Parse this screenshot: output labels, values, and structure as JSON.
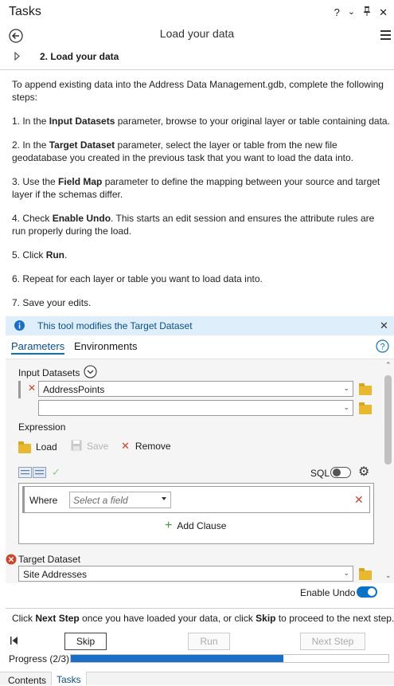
{
  "window": {
    "title": "Tasks",
    "icons": [
      "help-icon",
      "dropdown-icon",
      "pin-icon",
      "close-icon"
    ]
  },
  "header": {
    "title": "Load your data"
  },
  "step": {
    "label": "2.  Load your data"
  },
  "instructions": [
    {
      "parts": [
        {
          "t": "To append existing data into the Address Data Management.gdb, complete the following steps:",
          "b": false
        }
      ]
    },
    {
      "parts": [
        {
          "t": "1. In the ",
          "b": false
        },
        {
          "t": "Input Datasets",
          "b": true
        },
        {
          "t": " parameter, browse to your original layer or table containing data.",
          "b": false
        }
      ]
    },
    {
      "parts": [
        {
          "t": "2. In the ",
          "b": false
        },
        {
          "t": "Target Dataset",
          "b": true
        },
        {
          "t": " parameter, select the layer or table from the new file geodatabase you created in the previous task that you want to load the data into.",
          "b": false
        }
      ]
    },
    {
      "parts": [
        {
          "t": "3. Use the ",
          "b": false
        },
        {
          "t": "Field Map",
          "b": true
        },
        {
          "t": " parameter to define the mapping between your source and target layer if the schemas differ.",
          "b": false
        }
      ]
    },
    {
      "parts": [
        {
          "t": "4. Check ",
          "b": false
        },
        {
          "t": "Enable Undo",
          "b": true
        },
        {
          "t": ". This starts an edit session and ensures the attribute rules are run properly during the load.",
          "b": false
        }
      ]
    },
    {
      "parts": [
        {
          "t": "5. Click ",
          "b": false
        },
        {
          "t": "Run",
          "b": true
        },
        {
          "t": ".",
          "b": false
        }
      ]
    },
    {
      "parts": [
        {
          "t": "6. Repeat for each layer or table you want to load data into.",
          "b": false
        }
      ]
    },
    {
      "parts": [
        {
          "t": "7. Save your edits.",
          "b": false
        }
      ]
    }
  ],
  "info_bar": {
    "text": "This tool modifies the Target Dataset"
  },
  "tabs": {
    "parameters": "Parameters",
    "environments": "Environments"
  },
  "input_datasets": {
    "label": "Input Datasets",
    "value": "AddressPoints",
    "second_value": ""
  },
  "expression": {
    "label": "Expression",
    "load": "Load",
    "save": "Save",
    "remove": "Remove",
    "sql_label": "SQL",
    "where_label": "Where",
    "field_placeholder": "Select a field",
    "add_clause": "Add Clause"
  },
  "target_dataset": {
    "label": "Target Dataset",
    "value": "Site Addresses"
  },
  "enable_undo": {
    "label": "Enable Undo",
    "on": true
  },
  "footer": {
    "instruction_parts": [
      {
        "t": "Click ",
        "b": false
      },
      {
        "t": "Next Step",
        "b": true
      },
      {
        "t": " once you have loaded your data, or click ",
        "b": false
      },
      {
        "t": "Skip",
        "b": true
      },
      {
        "t": " to proceed to the next step.",
        "b": false
      }
    ],
    "skip": "Skip",
    "run": "Run",
    "next": "Next Step",
    "progress_label": "Progress (2/3)",
    "progress": 0.67
  },
  "bottom_tabs": {
    "contents": "Contents",
    "tasks": "Tasks"
  },
  "colors": {
    "accent": "#0b72c6",
    "error": "#c9452b",
    "info_bg": "#deeefb",
    "progress": "#1a6fc4"
  }
}
